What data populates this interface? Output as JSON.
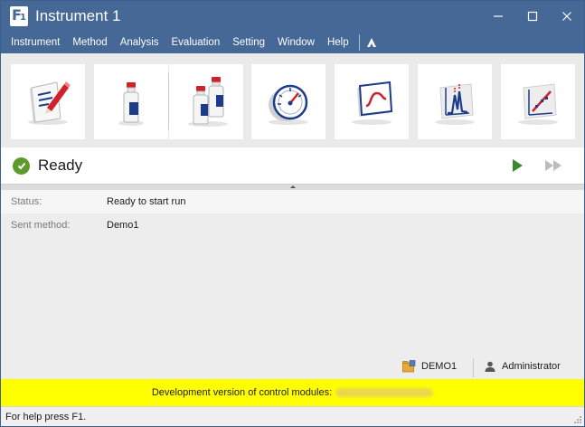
{
  "window": {
    "title": "Instrument 1",
    "icon": "f1-app-icon",
    "controls": [
      "minimize-icon",
      "maximize-icon",
      "close-icon"
    ]
  },
  "menu": {
    "items": [
      {
        "label": "Instrument"
      },
      {
        "label": "Method"
      },
      {
        "label": "Analysis"
      },
      {
        "label": "Evaluation"
      },
      {
        "label": "Setting"
      },
      {
        "label": "Window"
      },
      {
        "label": "Help"
      }
    ],
    "logo_icon": "vendor-logo-icon"
  },
  "toolbar": {
    "buttons": [
      {
        "icon": "edit-document-icon"
      },
      {
        "icon": "single-sample-bottle-icon"
      },
      {
        "icon": "multiple-sample-bottles-icon"
      },
      {
        "icon": "gauge-monitor-icon"
      },
      {
        "icon": "signal-monitor-icon"
      },
      {
        "icon": "chromatogram-icon"
      },
      {
        "icon": "calibration-plot-icon"
      }
    ]
  },
  "status": {
    "text": "Ready",
    "state_color": "#5c9a2c",
    "run_icon": "play-icon",
    "run_all_icon": "fast-forward-icon"
  },
  "info": {
    "rows": [
      {
        "label": "Status:",
        "value": "Ready to start run"
      },
      {
        "label": "Sent method:",
        "value": "Demo1"
      }
    ]
  },
  "footer": {
    "method": "DEMO1",
    "user": "Administrator",
    "dev_message": "Development version of control modules:",
    "help_text": "For help press F1."
  },
  "colors": {
    "title_bar": "#456897",
    "banner": "#ffff00",
    "accent_red": "#d0202a",
    "accent_blue": "#1c3b8a"
  }
}
